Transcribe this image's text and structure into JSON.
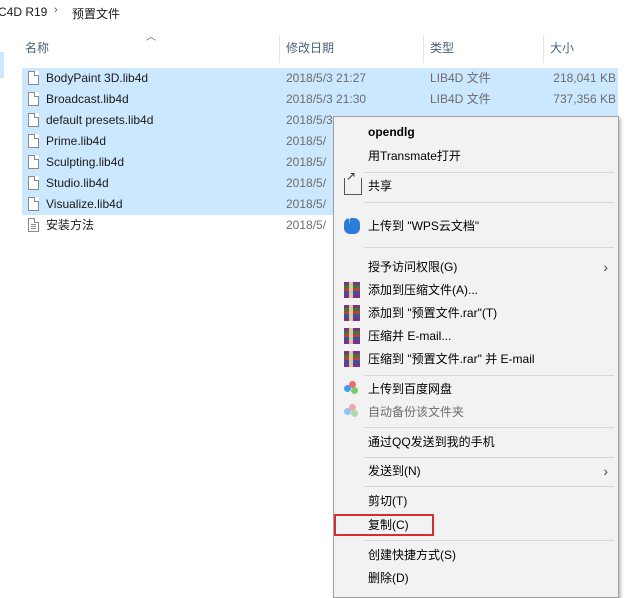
{
  "breadcrumb": {
    "root": "C4D R19",
    "separator": "›",
    "folder": "预置文件"
  },
  "columns": {
    "name": "名称",
    "date": "修改日期",
    "type": "类型",
    "size": "大小"
  },
  "files": [
    {
      "name": "BodyPaint 3D.lib4d",
      "date": "2018/5/3 21:27",
      "type": "LIB4D 文件",
      "size": "218,041 KB",
      "selected": true
    },
    {
      "name": "Broadcast.lib4d",
      "date": "2018/5/3 21:30",
      "type": "LIB4D 文件",
      "size": "737,356 KB",
      "selected": true
    },
    {
      "name": "default presets.lib4d",
      "date": "2018/5/3",
      "type": "",
      "size": "",
      "selected": true
    },
    {
      "name": "Prime.lib4d",
      "date": "2018/5/",
      "type": "",
      "size": "",
      "selected": true
    },
    {
      "name": "Sculpting.lib4d",
      "date": "2018/5/",
      "type": "",
      "size": "",
      "selected": true
    },
    {
      "name": "Studio.lib4d",
      "date": "2018/5/",
      "type": "",
      "size": "",
      "selected": true
    },
    {
      "name": "Visualize.lib4d",
      "date": "2018/5/",
      "type": "",
      "size": "",
      "selected": true
    },
    {
      "name": "安装方法",
      "date": "2018/5/",
      "type": "",
      "size": "",
      "selected": false
    }
  ],
  "context_menu": {
    "items": [
      {
        "label": "opendlg"
      },
      {
        "label": "用Transmate打开"
      },
      {
        "label": "共享",
        "icon": "share-icon"
      },
      {
        "label": "上传到 \"WPS云文档\"",
        "icon": "wps-cloud-icon"
      },
      {
        "label": "授予访问权限(G)",
        "icon": "submenu-arrow-icon"
      },
      {
        "label": "添加到压缩文件(A)...",
        "icon": "winrar-icon"
      },
      {
        "label": "添加到 \"预置文件.rar\"(T)",
        "icon": "winrar-icon"
      },
      {
        "label": "压缩并 E-mail...",
        "icon": "winrar-icon"
      },
      {
        "label": "压缩到 \"预置文件.rar\" 并 E-mail",
        "icon": "winrar-icon"
      },
      {
        "label": "上传到百度网盘",
        "icon": "baidu-netdisk-icon"
      },
      {
        "label": "自动备份该文件夹",
        "icon": "baidu-netdisk-icon",
        "disabled": true
      },
      {
        "label": "通过QQ发送到我的手机"
      },
      {
        "label": "发送到(N)",
        "icon": "submenu-arrow-icon"
      },
      {
        "label": "剪切(T)"
      },
      {
        "label": "复制(C)",
        "highlighted": true
      },
      {
        "label": "创建快捷方式(S)"
      },
      {
        "label": "删除(D)"
      }
    ],
    "arrow_glyph": "›",
    "highlight_color": "#d32f2f"
  },
  "colors": {
    "selection": "#cce8ff",
    "menu_bg": "#f2f2f2",
    "header_text": "#4c607a"
  }
}
